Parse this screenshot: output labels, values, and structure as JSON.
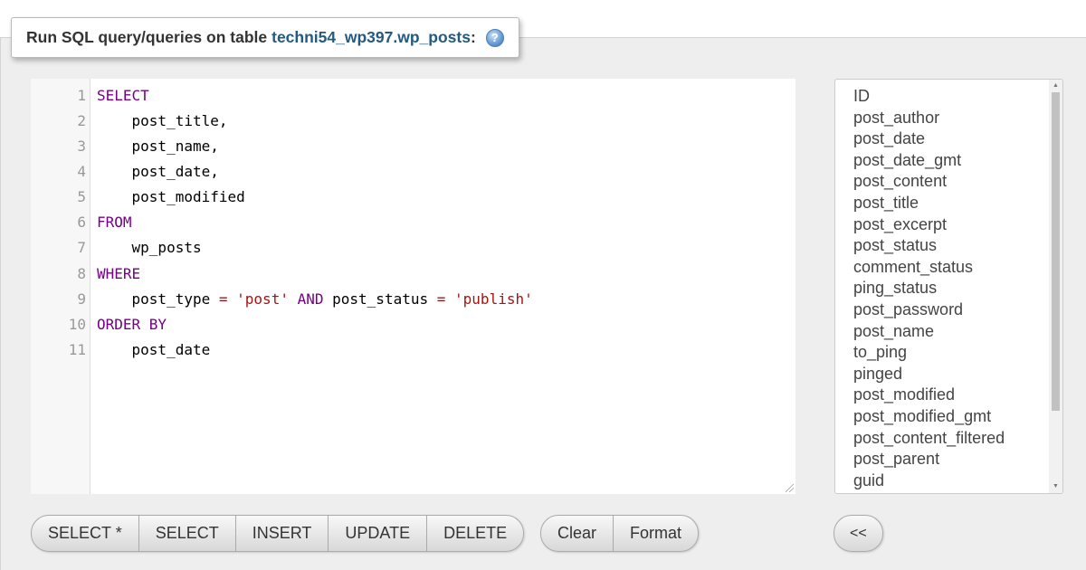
{
  "fieldset": {
    "legend_text": "Run SQL query/queries on table",
    "table_link": "techni54_wp397.wp_posts",
    "colon": ":",
    "help_icon": "help-icon"
  },
  "editor": {
    "line_numbers": [
      "1",
      "2",
      "3",
      "4",
      "5",
      "6",
      "7",
      "8",
      "9",
      "10",
      "11"
    ],
    "lines": [
      {
        "kw": "SELECT"
      },
      {
        "indent": "    ",
        "text": "post_title,"
      },
      {
        "indent": "    ",
        "text": "post_name,"
      },
      {
        "indent": "    ",
        "text": "post_date,"
      },
      {
        "indent": "    ",
        "text": "post_modified"
      },
      {
        "kw": "FROM"
      },
      {
        "indent": "    ",
        "text": "wp_posts"
      },
      {
        "kw": "WHERE"
      },
      {
        "indent": "    ",
        "a": "post_type",
        "op1": "=",
        "s1": "'post'",
        "kw2": "AND",
        "b": "post_status",
        "op2": "=",
        "s2": "'publish'"
      },
      {
        "kw": "ORDER BY"
      },
      {
        "indent": "    ",
        "text": "post_date"
      }
    ]
  },
  "columns": [
    "ID",
    "post_author",
    "post_date",
    "post_date_gmt",
    "post_content",
    "post_title",
    "post_excerpt",
    "post_status",
    "comment_status",
    "ping_status",
    "post_password",
    "post_name",
    "to_ping",
    "pinged",
    "post_modified",
    "post_modified_gmt",
    "post_content_filtered",
    "post_parent",
    "guid"
  ],
  "buttons": {
    "select_all": "SELECT *",
    "select": "SELECT",
    "insert": "INSERT",
    "update": "UPDATE",
    "delete": "DELETE",
    "clear": "Clear",
    "format": "Format",
    "insert_column": "<<"
  },
  "colors": {
    "keyword": "#770088",
    "string": "#aa1111",
    "operator": "#981a1a",
    "link": "#235a81"
  }
}
